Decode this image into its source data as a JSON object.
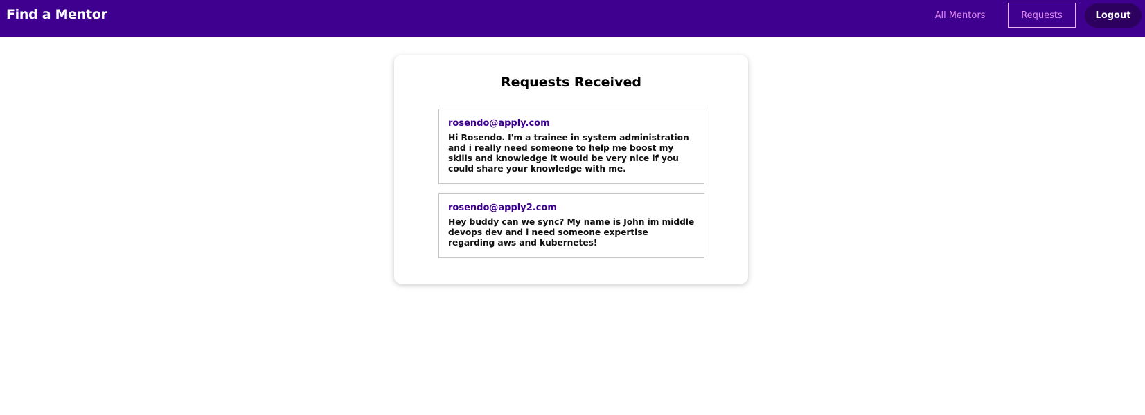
{
  "header": {
    "brand": "Find a Mentor",
    "nav": {
      "all_mentors": "All Mentors",
      "requests": "Requests",
      "logout": "Logout"
    }
  },
  "main": {
    "title": "Requests Received",
    "requests": [
      {
        "email": "rosendo@apply.com",
        "message": "Hi Rosendo. I'm a trainee in system administration and i really need someone to help me boost my skills and knowledge it would be very nice if you could share your knowledge with me."
      },
      {
        "email": "rosendo@apply2.com",
        "message": "Hey buddy can we sync? My name is John im middle devops dev and i need someone expertise regarding aws and kubernetes!"
      }
    ]
  },
  "colors": {
    "navbar": "#3f0090",
    "nav_link": "#e58bf0",
    "logout_bg": "#2d0060",
    "email": "#3f0090"
  }
}
